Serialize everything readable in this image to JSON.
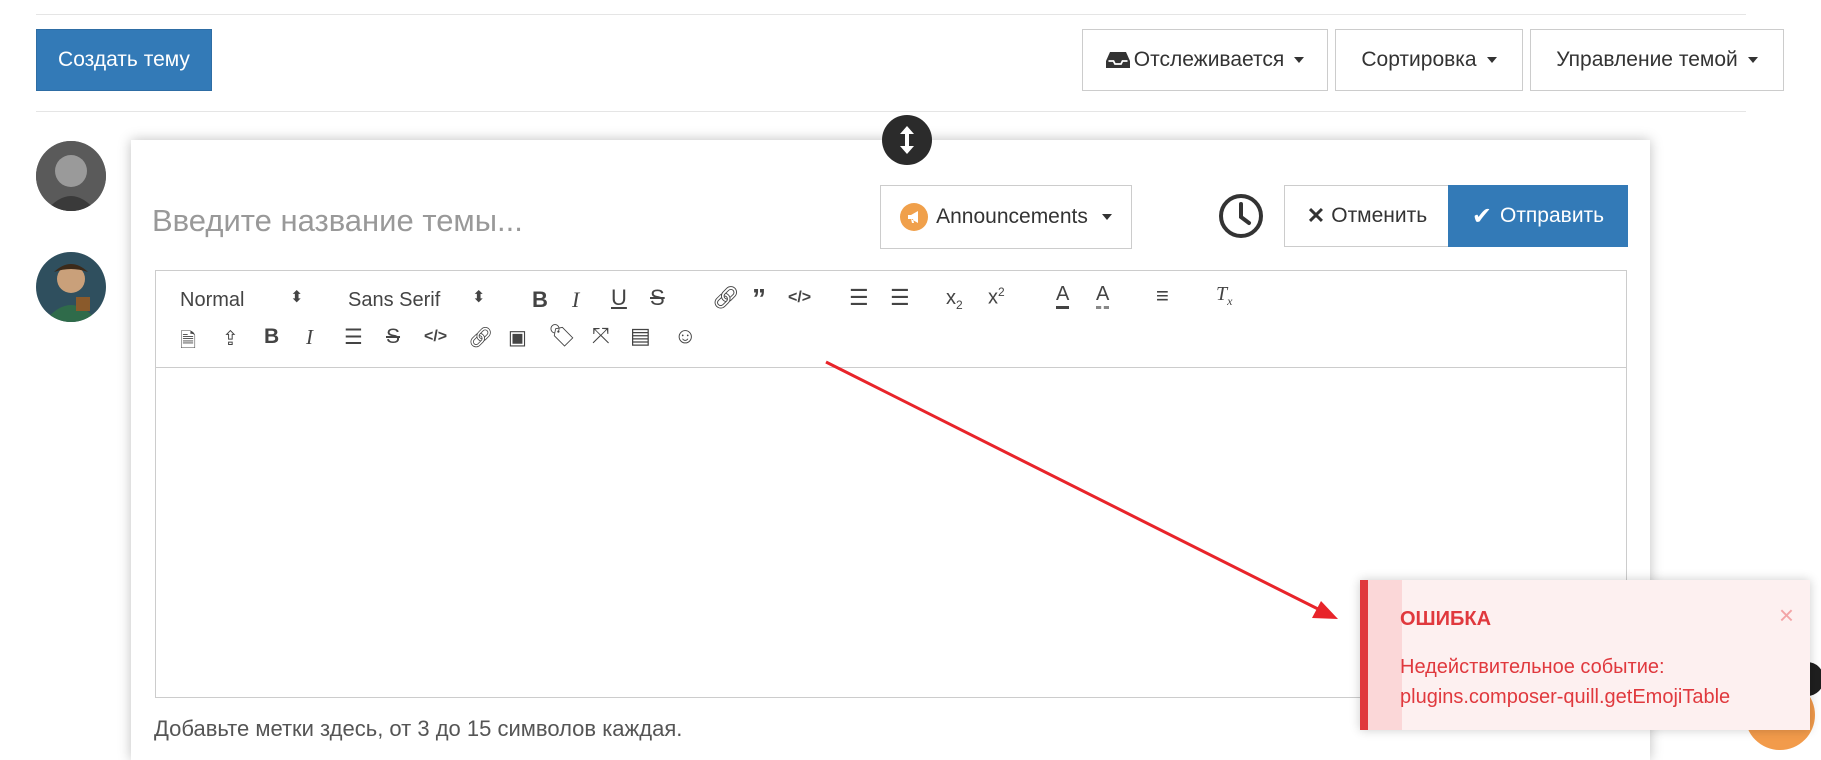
{
  "header": {
    "create_topic": "Создать тему",
    "watching": "Отслеживается",
    "sort": "Сортировка",
    "topic_tools": "Управление темой"
  },
  "composer": {
    "title_placeholder": "Введите название темы...",
    "category": "Announcements",
    "cancel": "Отменить",
    "submit": "Отправить",
    "toolbar": {
      "format": "Normal",
      "font": "Sans Serif"
    },
    "tags_placeholder": "Добавьте метки здесь, от 3 до 15 символов каждая."
  },
  "toast": {
    "title": "ОШИБКА",
    "message_line1": "Недействительное событие:",
    "message_line2": "plugins.composer-quill.getEmojiTable",
    "close": "×"
  },
  "colors": {
    "primary": "#337ab7",
    "error": "#e0393e",
    "category_icon": "#f0a04b"
  },
  "icons": [
    "inbox-icon",
    "caret-down-icon",
    "resize-icon",
    "bullhorn-icon",
    "clock-icon",
    "times-icon",
    "check-icon",
    "bold-icon",
    "italic-icon",
    "underline-icon",
    "strike-icon",
    "link-icon",
    "quote-icon",
    "code-icon",
    "ordered-list-icon",
    "bullet-list-icon",
    "subscript-icon",
    "superscript-icon",
    "font-color-icon",
    "background-color-icon",
    "align-icon",
    "clear-format-icon",
    "file-icon",
    "upload-icon",
    "image-icon",
    "tags-icon",
    "fullscreen-icon",
    "id-card-icon",
    "smile-icon"
  ]
}
